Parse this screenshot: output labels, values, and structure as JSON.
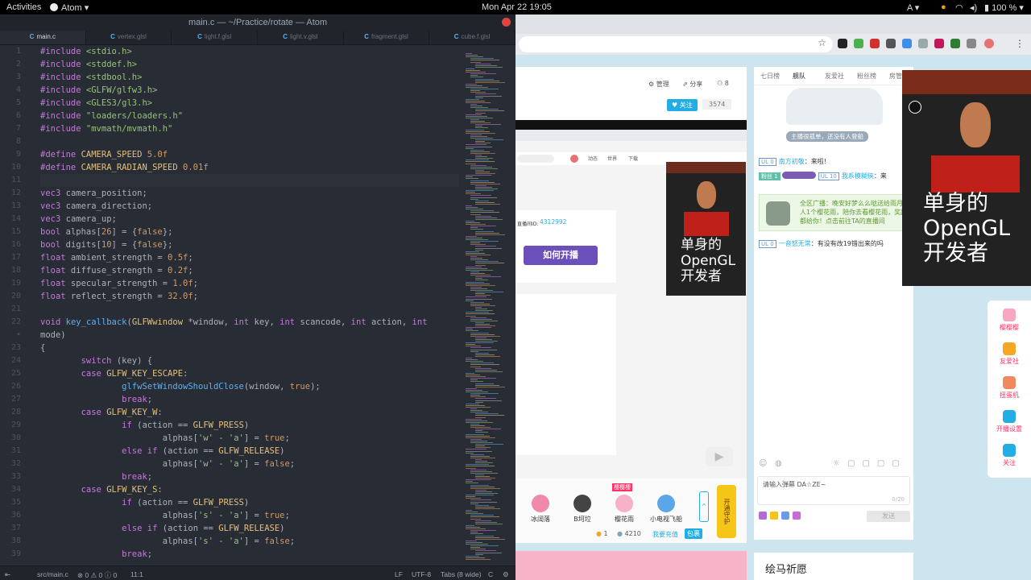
{
  "topbar": {
    "activities": "Activities",
    "app_menu": "Atom ▾",
    "datetime": "Mon Apr 22  19:05",
    "input_method": "A ▾",
    "battery": "100 %"
  },
  "atom": {
    "title": "main.c — ~/Practice/rotate — Atom",
    "tabs": [
      "main.c",
      "vertex.glsl",
      "light.f.glsl",
      "light.v.glsl",
      "fragment.glsl",
      "cube.f.glsl"
    ],
    "active_tab": 0,
    "line_numbers": [
      "1",
      "2",
      "3",
      "4",
      "5",
      "6",
      "7",
      "8",
      "9",
      "10",
      "11",
      "12",
      "13",
      "14",
      "15",
      "16",
      "17",
      "18",
      "19",
      "20",
      "21",
      "22",
      "•",
      "23",
      "24",
      "25",
      "26",
      "27",
      "28",
      "29",
      "30",
      "31",
      "32",
      "33",
      "34",
      "35",
      "36",
      "37",
      "38",
      "39"
    ],
    "code_lines": [
      "#include <stdio.h>",
      "#include <stddef.h>",
      "#include <stdbool.h>",
      "#include <GLFW/glfw3.h>",
      "#include <GLES3/gl3.h>",
      "#include \"loaders/loaders.h\"",
      "#include \"mvmath/mvmath.h\"",
      "",
      "#define CAMERA_SPEED 5.0f",
      "#define CAMERA_RADIAN_SPEED 0.01f",
      "",
      "vec3 camera_position;",
      "vec3 camera_direction;",
      "vec3 camera_up;",
      "bool alphas[26] = {false};",
      "bool digits[10] = {false};",
      "float ambient_strength = 0.5f;",
      "float diffuse_strength = 0.2f;",
      "float specular_strength = 1.0f;",
      "float reflect_strength = 32.0f;",
      "",
      "void key_callback(GLFWwindow *window, int key, int scancode, int action, int",
      "mode)",
      "{",
      "        switch (key) {",
      "        case GLFW_KEY_ESCAPE:",
      "                glfwSetWindowShouldClose(window, true);",
      "                break;",
      "        case GLFW_KEY_W:",
      "                if (action == GLFW_PRESS)",
      "                        alphas['w' - 'a'] = true;",
      "                else if (action == GLFW_RELEASE)",
      "                        alphas['w' - 'a'] = false;",
      "                break;",
      "        case GLFW_KEY_S:",
      "                if (action == GLFW_PRESS)",
      "                        alphas['s' - 'a'] = true;",
      "                else if (action == GLFW_RELEASE)",
      "                        alphas['s' - 'a'] = false;",
      "                break;"
    ],
    "status": {
      "file": "src/main.c",
      "diagnostics": "⊗ 0 ⚠ 0 ⓘ 0",
      "cursor": "11:1",
      "line_ending": "LF",
      "encoding": "UTF-8",
      "indent": "Tabs (8 wide)",
      "grammar": "C"
    }
  },
  "browser": {
    "room": {
      "manage": "管理",
      "share": "分享",
      "share_count": "8",
      "follow": "♥ 关注",
      "followers": "3574",
      "room_id_label": "直播间ID:",
      "room_id": "4312992",
      "start_button": "如何开播",
      "inner_tabs": [
        "动态",
        "世界",
        "下载"
      ]
    },
    "gifts": [
      {
        "name": "冰阔落",
        "color": "#f08aa8"
      },
      {
        "name": "B坷垃",
        "color": "#444444"
      },
      {
        "name": "樱花雨",
        "color": "#f7b0c8",
        "badge": "樱樱樱"
      },
      {
        "name": "小电视飞船",
        "color": "#5aa6e8"
      }
    ],
    "wallet": {
      "gold": "1",
      "silver": "4210",
      "recharge": "我要充值",
      "bag": "包裹"
    },
    "vip_banner": "开通守护",
    "rank_tabs": [
      "七日榜",
      "舰队",
      "友爱社",
      "粉丝榜",
      "房管"
    ],
    "no_guard_text": "主播很孤单，还没有人登船",
    "chat": [
      {
        "level": "UL 0",
        "user": "南方初敬",
        "text": "来啦!"
      },
      {
        "level": "UL 10",
        "user": "我系模糊侠",
        "text": "来",
        "badge": "粉丝",
        "badge_level": "1"
      },
      {
        "level": "",
        "user": "全区广播",
        "text": "晚安好梦么么哒送给雨月人1个樱花雨，陪你去看樱花雨，奖励都给你！点击前往TA的直播间"
      },
      {
        "level": "UL 0",
        "user": "一音怒无常",
        "text": "有没有改19错出来的吗"
      }
    ],
    "danmaku_placeholder": "请输入弹幕 DA☆ZE~",
    "danmaku_count": "0/20",
    "send": "发送",
    "side_buttons": [
      "樱樱樱",
      "友爱社",
      "扭蛋机",
      "开播设置",
      "关注"
    ],
    "wish_title": "绘马祈愿",
    "overlay_text": [
      "单身的",
      "OpenGL",
      "开发者"
    ]
  }
}
